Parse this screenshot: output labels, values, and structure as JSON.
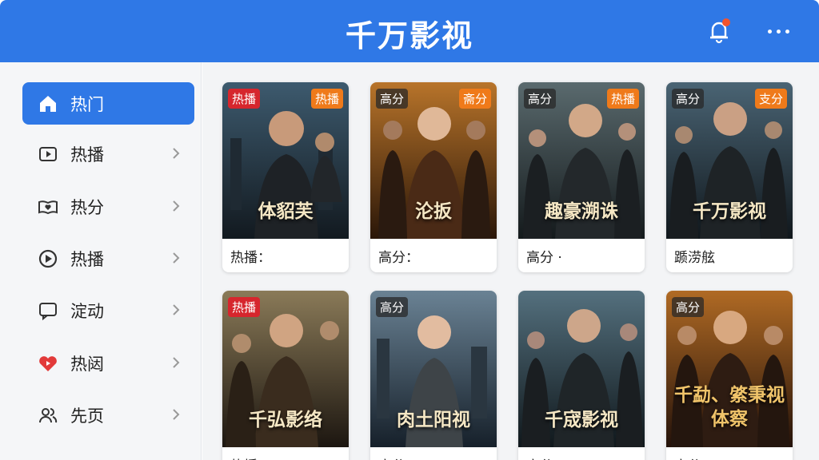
{
  "header": {
    "title": "千万影视",
    "bell_icon": "bell-icon",
    "more_icon": "more-icon"
  },
  "sidebar": {
    "items": [
      {
        "label": "热门",
        "icon": "home-icon",
        "active": true
      },
      {
        "label": "热播",
        "icon": "play-square-icon"
      },
      {
        "label": "热分",
        "icon": "book-heart-icon"
      },
      {
        "label": "热播",
        "icon": "play-circle-icon"
      },
      {
        "label": "淀动",
        "icon": "chat-icon"
      },
      {
        "label": "热闼",
        "icon": "heart-play-icon"
      },
      {
        "label": "先页",
        "icon": "users-icon"
      }
    ]
  },
  "cards": [
    {
      "title": "体貂芙",
      "caption": "热播：",
      "badge_left": "热播",
      "badge_right": "热播"
    },
    {
      "title": "沦扳",
      "caption": "高分：",
      "badge_left": "高分",
      "badge_right": "斋分"
    },
    {
      "title": "趣豪溯诛",
      "caption": "高分 ·",
      "badge_left": "高分",
      "badge_right": "热播"
    },
    {
      "title": "千万影视",
      "caption": "踬涝舷",
      "badge_left": "高分",
      "badge_right": "支分"
    },
    {
      "title": "千弘影络",
      "caption": "热播：",
      "badge_left": "热播",
      "badge_right": ""
    },
    {
      "title": "肉土阳视",
      "caption": "高分：",
      "badge_left": "高分",
      "badge_right": ""
    },
    {
      "title": "千宬影视",
      "caption": "高分：",
      "badge_left": "",
      "badge_right": ""
    },
    {
      "title": "千勐、綮秉视 体察",
      "caption": "高分：",
      "badge_left": "高分",
      "badge_right": ""
    }
  ],
  "colors": {
    "accent": "#2f78e6",
    "hot_badge": "#d6262d",
    "orange_badge": "#ef7a1a",
    "notification_dot": "#f2542d"
  }
}
